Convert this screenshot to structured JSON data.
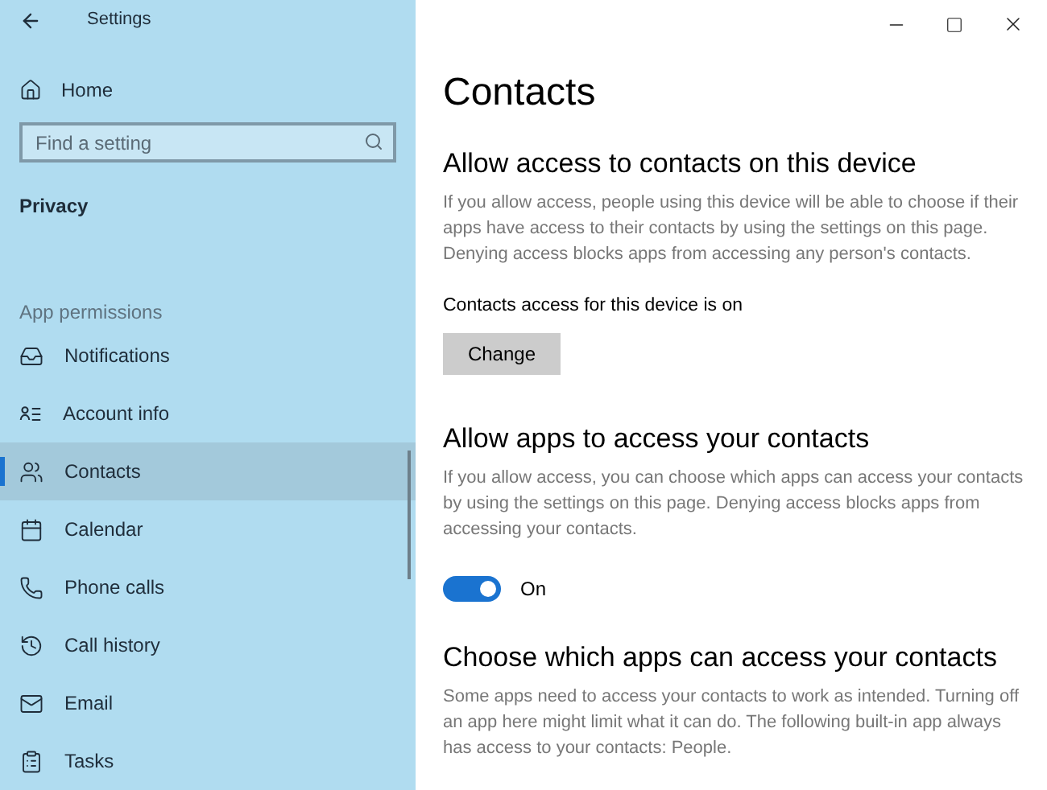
{
  "window": {
    "title": "Settings"
  },
  "sidebar": {
    "home": "Home",
    "search": {
      "placeholder": "Find a setting"
    },
    "section": "Privacy",
    "group": "App permissions",
    "items": [
      {
        "label": "Notifications",
        "selected": false
      },
      {
        "label": "Account info",
        "selected": false
      },
      {
        "label": "Contacts",
        "selected": true
      },
      {
        "label": "Calendar",
        "selected": false
      },
      {
        "label": "Phone calls",
        "selected": false
      },
      {
        "label": "Call history",
        "selected": false
      },
      {
        "label": "Email",
        "selected": false
      },
      {
        "label": "Tasks",
        "selected": false
      }
    ]
  },
  "page": {
    "title": "Contacts",
    "sections": [
      {
        "kind": "button",
        "heading": "Allow access to contacts on this device",
        "description": "If you allow access, people using this device will be able to choose if their apps have access to their contacts by using the settings on this page. Denying access blocks apps from accessing any person's contacts.",
        "status": "Contacts access for this device is on",
        "button": "Change"
      },
      {
        "kind": "toggle",
        "heading": "Allow apps to access your contacts",
        "description": "If you allow access, you can choose which apps can access your contacts by using the settings on this page. Denying access blocks apps from accessing your contacts.",
        "on": true,
        "toggle_label": "On"
      },
      {
        "kind": "text",
        "heading": "Choose which apps can access your contacts",
        "description": "Some apps need to access your contacts to work as intended. Turning off an app here might limit what it can do. The following built-in app always has access to your contacts: People."
      }
    ]
  }
}
